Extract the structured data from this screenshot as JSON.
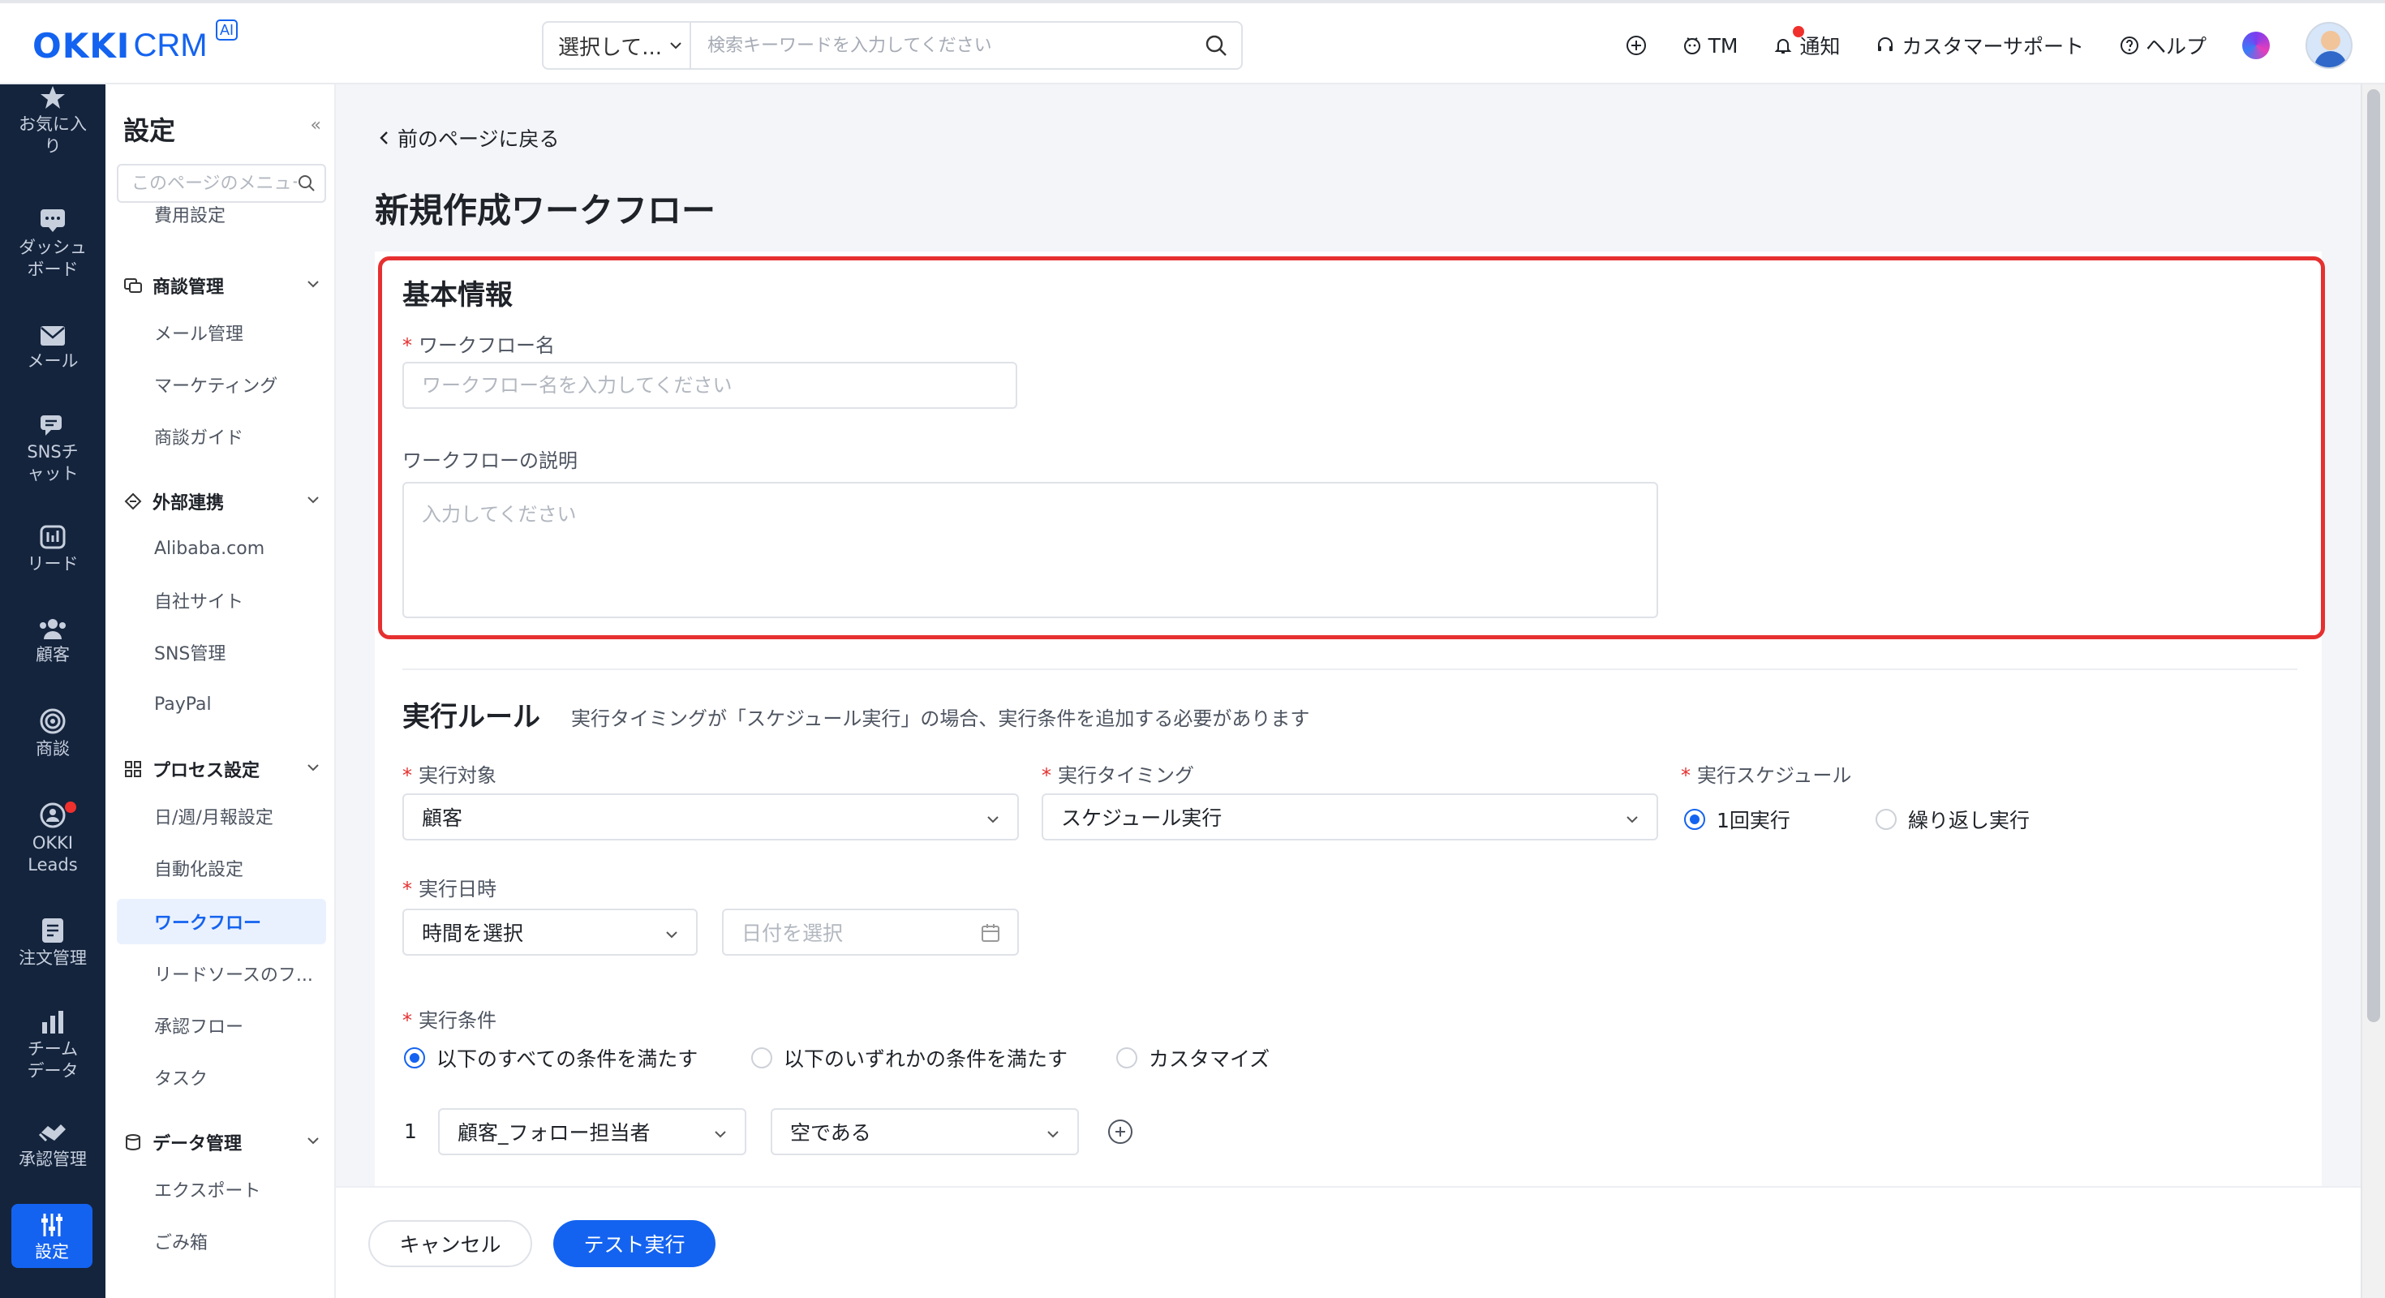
{
  "topbar": {
    "logo": {
      "okki": "OKKI",
      "crm": "CRM",
      "ai_badge": "AI"
    },
    "search": {
      "scope": "選択して...",
      "placeholder": "検索キーワードを入力してください",
      "value": ""
    },
    "actions": [
      {
        "label": "",
        "icon": "plus-circle-icon"
      },
      {
        "label": "TM",
        "icon": "tm-icon"
      },
      {
        "label": "通知",
        "icon": "bell-icon"
      },
      {
        "label": "カスタマーサポート",
        "icon": "headset-icon"
      },
      {
        "label": "ヘルプ",
        "icon": "help-icon"
      }
    ]
  },
  "leftnav": {
    "items": [
      {
        "label": "お気に入り",
        "icon": "star-icon"
      },
      {
        "label": "ダッシュボード",
        "icon": "dashboard-icon"
      },
      {
        "label": "メール",
        "icon": "mail-icon"
      },
      {
        "label": "SNSチャット",
        "icon": "chat-icon"
      },
      {
        "label": "リード",
        "icon": "lead-icon"
      },
      {
        "label": "顧客",
        "icon": "customer-icon"
      },
      {
        "label": "商談",
        "icon": "target-icon"
      },
      {
        "label": "OKKI Leads",
        "icon": "okki-leads-icon"
      },
      {
        "label": "注文管理",
        "icon": "order-icon"
      },
      {
        "label": "チームデータ",
        "icon": "bar-chart-icon"
      },
      {
        "label": "承認管理",
        "icon": "approval-icon"
      },
      {
        "label": "設定",
        "icon": "settings-sliders-icon"
      }
    ]
  },
  "sidebar": {
    "title": "設定",
    "collapse": "«",
    "search_placeholder": "このページのメニュー",
    "items": {
      "cost": "費用設定",
      "group_deal": "商談管理",
      "mail": "メール管理",
      "marketing": "マーケティング",
      "deal_guide": "商談ガイド",
      "group_external": "外部連携",
      "alibaba": "Alibaba.com",
      "own_site": "自社サイト",
      "sns": "SNS管理",
      "paypal": "PayPal",
      "group_process": "プロセス設定",
      "report": "日/週/月報設定",
      "automation": "自動化設定",
      "workflow": "ワークフロー",
      "lead_source": "リードソースのフ...",
      "approval_flow": "承認フロー",
      "task": "タスク",
      "group_data": "データ管理",
      "export": "エクスポート",
      "trash": "ごみ箱"
    }
  },
  "main": {
    "back": "前のページに戻る",
    "title": "新規作成ワークフロー",
    "basic": {
      "title": "基本情報",
      "name_label": "ワークフロー名",
      "name_placeholder": "ワークフロー名を入力してください",
      "desc_label": "ワークフローの説明",
      "desc_placeholder": "入力してください"
    },
    "rules": {
      "title": "実行ルール",
      "note": "実行タイミングが「スケジュール実行」の場合、実行条件を追加する必要があります",
      "target_label": "実行対象",
      "target_value": "顧客",
      "timing_label": "実行タイミング",
      "timing_value": "スケジュール実行",
      "schedule_label": "実行スケジュール",
      "schedule_once": "1回実行",
      "schedule_repeat": "繰り返し実行",
      "datetime_label": "実行日時",
      "time_value": "時間を選択",
      "date_placeholder": "日付を選択",
      "condition_label": "実行条件",
      "cond_all": "以下のすべての条件を満たす",
      "cond_any": "以下のいずれかの条件を満たす",
      "cond_custom": "カスタマイズ",
      "condition_rows": [
        {
          "index": "1",
          "field": "顧客_フォロー担当者",
          "operator": "空である"
        }
      ]
    }
  },
  "footer": {
    "cancel": "キャンセル",
    "test_run": "テスト実行"
  },
  "colors": {
    "brand": "#1463f0",
    "nav_bg": "#14243d",
    "highlight": "#e63030",
    "required": "#e63030"
  }
}
